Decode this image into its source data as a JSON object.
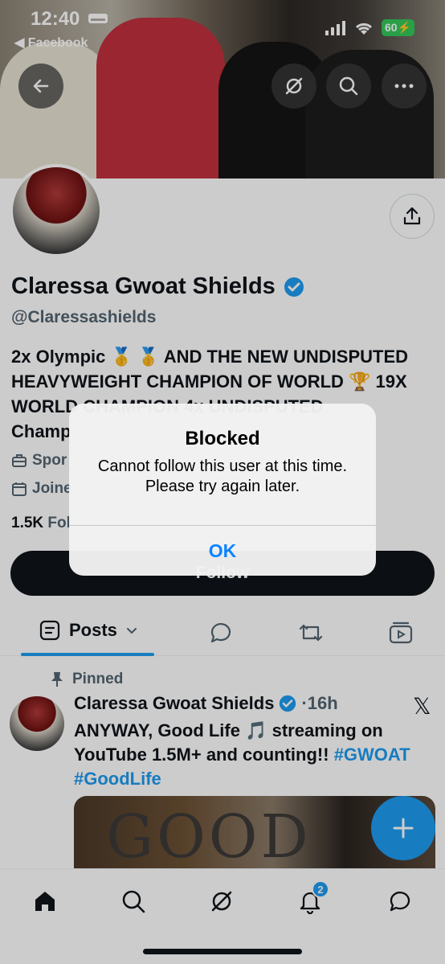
{
  "status_bar": {
    "time": "12:40",
    "back_app": "Facebook",
    "battery": "60"
  },
  "profile": {
    "name": "Claressa Gwoat Shields",
    "handle": "@Claressashields",
    "bio_line1": "2x Olympic 🥇 🥇 AND THE NEW UNDISPUTED",
    "bio_line2": "HEAVYWEIGHT CHAMPION OF WORLD 🏆 19X",
    "bio_line3": "WORLD CHAMPION 4x UNDISPUTED",
    "bio_line4": "Champ",
    "category": "Spor",
    "joined": "Joine",
    "followers_count": "1.5K",
    "followers_label": "Fol",
    "follow_label": "Follow",
    "verified_color": "#1d9bf0"
  },
  "tabs": {
    "posts_label": "Posts"
  },
  "post": {
    "pinned_label": "Pinned",
    "author": "Claressa Gwoat Shields",
    "time": "·16h",
    "text_part1": "ANYWAY, Good Life 🎵 streaming on YouTube 1.5M+ and counting!! ",
    "hashtag1": "#GWOAT",
    "hashtag2": "#GoodLife",
    "image_title": "GOOD"
  },
  "bottom_nav": {
    "notifications_badge": "2"
  },
  "alert": {
    "title": "Blocked",
    "message": "Cannot follow this user at this time. Please try again later.",
    "ok_label": "OK"
  },
  "colors": {
    "accent": "#1d9bf0",
    "ios_blue": "#0a84ff",
    "battery_green": "#34c759"
  }
}
